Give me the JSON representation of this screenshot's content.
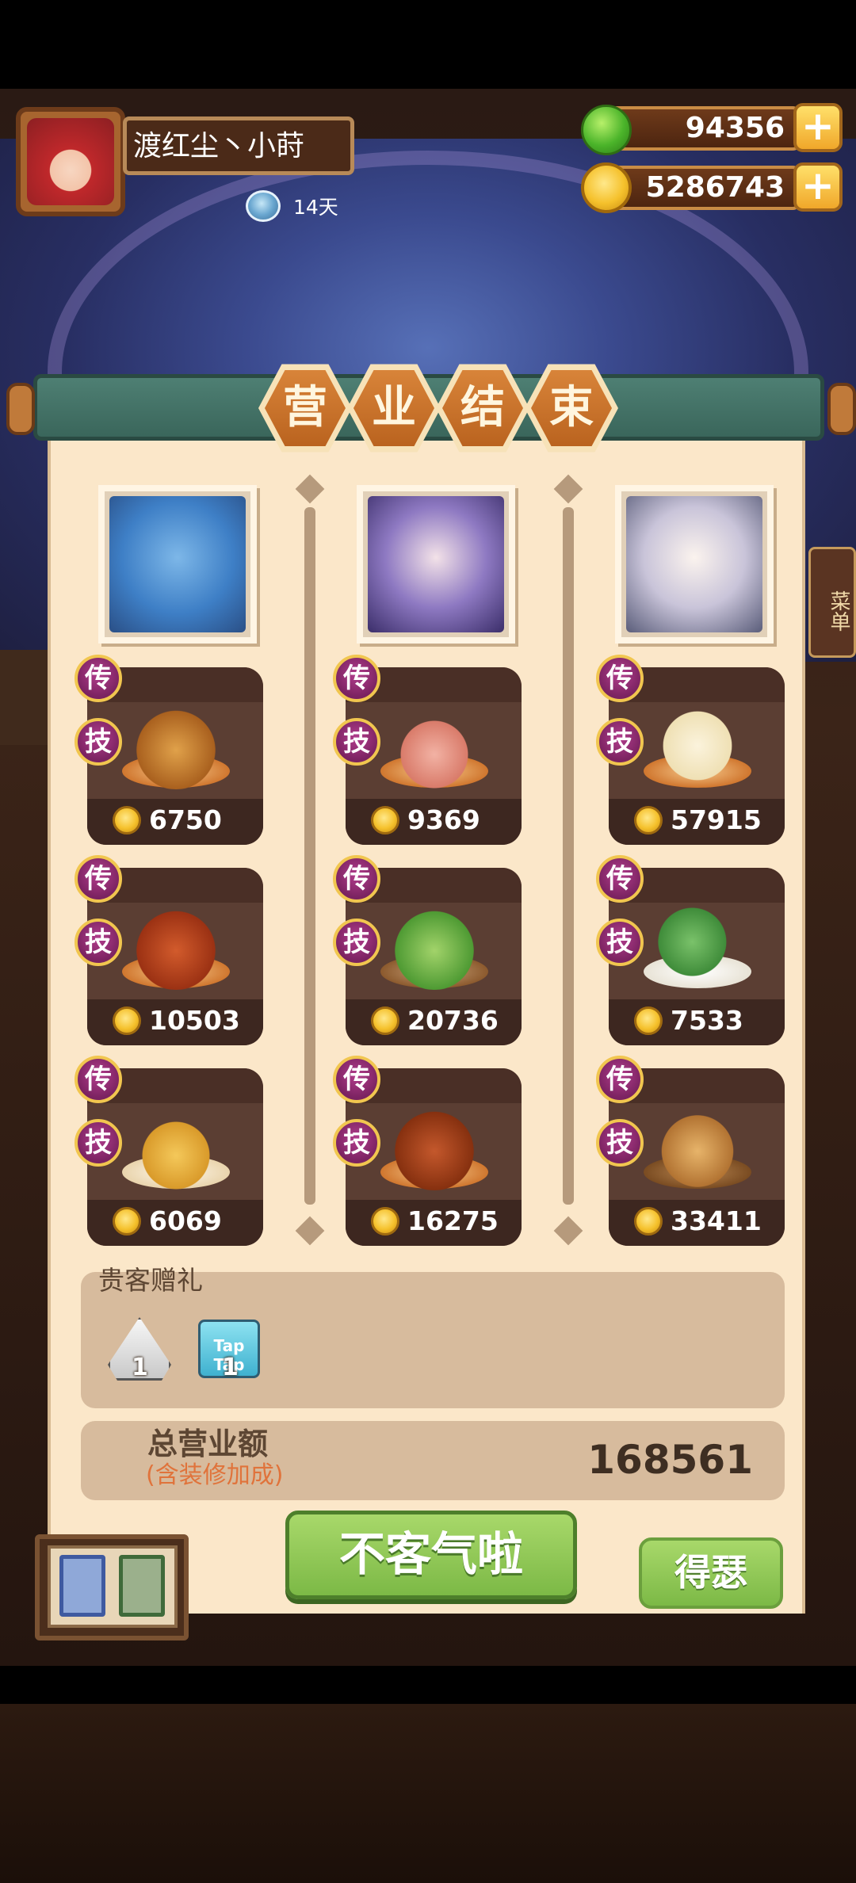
{
  "header": {
    "player_name": "渡红尘丶小莳",
    "days": "14天",
    "apples": "94356",
    "coins": "5286743",
    "plus": "+"
  },
  "banner": {
    "chars": [
      "营",
      "业",
      "结",
      "束"
    ]
  },
  "badges": {
    "legend": "传",
    "skill": "技"
  },
  "dishes": [
    [
      {
        "price": "6750"
      },
      {
        "price": "10503"
      },
      {
        "price": "6069"
      }
    ],
    [
      {
        "price": "9369"
      },
      {
        "price": "20736"
      },
      {
        "price": "16275"
      }
    ],
    [
      {
        "price": "57915"
      },
      {
        "price": "7533"
      },
      {
        "price": "33411"
      }
    ]
  ],
  "gifts": {
    "title": "贵客赠礼",
    "items": [
      {
        "count": "1"
      },
      {
        "count": "1",
        "label": "Tap Tap"
      }
    ]
  },
  "total": {
    "label": "总营业额",
    "sub": "(含装修加成)",
    "value": "168561"
  },
  "buttons": {
    "main": "不客气啦",
    "side": "得瑟"
  },
  "side_menu": "菜单",
  "colors": {
    "panel": "#fbe7c9",
    "card": "#5b3e33",
    "badge": "#7b2361",
    "button_green": "#7cb946",
    "banner": "#3a665b"
  }
}
